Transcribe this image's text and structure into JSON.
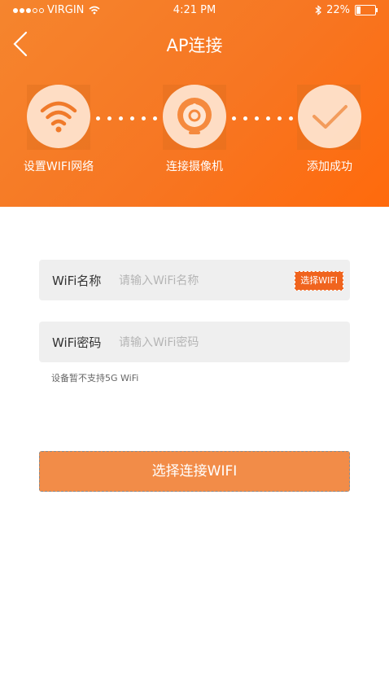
{
  "status_bar": {
    "carrier": "VIRGIN",
    "time": "4:21 PM",
    "battery": "22%"
  },
  "header": {
    "title": "AP连接"
  },
  "steps": [
    {
      "label": "设置WIFI网络",
      "icon": "wifi-icon"
    },
    {
      "label": "连接摄像机",
      "icon": "camera-icon"
    },
    {
      "label": "添加成功",
      "icon": "checkmark-icon"
    }
  ],
  "form": {
    "wifi_name": {
      "label": "WiFi名称",
      "placeholder": "请输入WiFi名称",
      "value": ""
    },
    "select_wifi_label": "选择WIFI",
    "wifi_password": {
      "label": "WiFi密码",
      "placeholder": "请输入WiFi密码",
      "value": ""
    },
    "note": "设备暂不支持5G WiFi"
  },
  "actions": {
    "connect_label": "选择连接WIFI"
  },
  "colors": {
    "accent": "#f77622",
    "button": "#f28c48",
    "field_bg": "#efefef"
  }
}
